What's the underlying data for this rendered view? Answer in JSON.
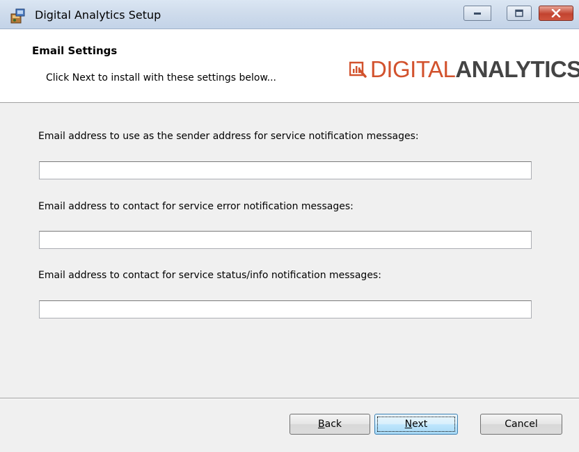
{
  "window": {
    "title": "Digital Analytics Setup",
    "controls": [
      "minimize-icon",
      "maximize-icon",
      "close-icon"
    ],
    "close_color": "#c2432f"
  },
  "header": {
    "title": "Email Settings",
    "subtitle": "Click Next to install with these settings below...",
    "logo": {
      "light": "DIGITAL",
      "bold": "ANALYTICS",
      "suffix": ".",
      "accent_color": "#d2522d",
      "dark_color": "#444444"
    }
  },
  "fields": [
    {
      "label": "Email address to use as the sender address for service notification messages:",
      "value": ""
    },
    {
      "label": "Email address to contact for service error notification messages:",
      "value": ""
    },
    {
      "label": "Email address to contact for service status/info notification messages:",
      "value": ""
    }
  ],
  "buttons": {
    "back": {
      "accel": "B",
      "rest": "ack"
    },
    "next": {
      "accel": "N",
      "rest": "ext"
    },
    "cancel": "Cancel"
  }
}
